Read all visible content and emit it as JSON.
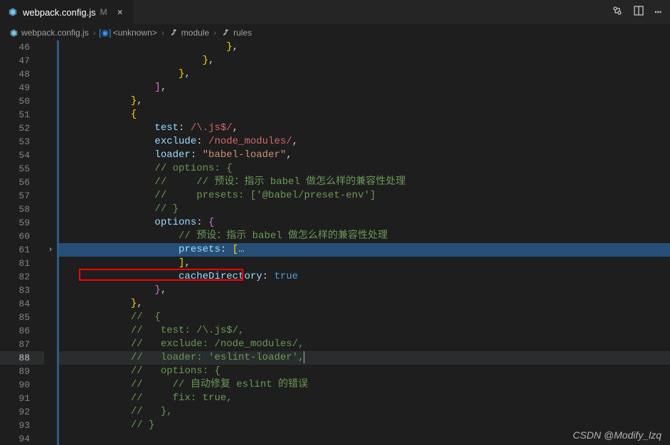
{
  "tab": {
    "filename": "webpack.config.js",
    "modified_badge": "M"
  },
  "title_actions": {
    "compare": "⇄",
    "split": "▯",
    "more": "⋯"
  },
  "breadcrumb": {
    "file": "webpack.config.js",
    "segment1": "<unknown>",
    "segment2": "module",
    "segment3": "rules"
  },
  "gutter": {
    "fold_marker": "›"
  },
  "lines": [
    {
      "n": 46,
      "tokens": [
        [
          "                            ",
          "punct"
        ],
        [
          "}",
          {
            "c": "bracket"
          }
        ],
        [
          ",",
          "punct"
        ]
      ]
    },
    {
      "n": 47,
      "tokens": [
        [
          "                        ",
          "punct"
        ],
        [
          "}",
          {
            "c": "bracket"
          }
        ],
        [
          ",",
          "punct"
        ]
      ]
    },
    {
      "n": 48,
      "tokens": [
        [
          "                    ",
          "punct"
        ],
        [
          "}",
          {
            "c": "bracket"
          }
        ],
        [
          ",",
          "punct"
        ]
      ]
    },
    {
      "n": 49,
      "tokens": [
        [
          "                ",
          "punct"
        ],
        [
          "]",
          "bracket2"
        ],
        [
          ",",
          "punct"
        ]
      ]
    },
    {
      "n": 50,
      "tokens": [
        [
          "            ",
          "punct"
        ],
        [
          "}",
          {
            "c": "bracket"
          }
        ],
        [
          ",",
          "punct"
        ]
      ]
    },
    {
      "n": 51,
      "tokens": [
        [
          "            ",
          "punct"
        ],
        [
          "{",
          "bracket"
        ]
      ]
    },
    {
      "n": 52,
      "tokens": [
        [
          "                ",
          "punct"
        ],
        [
          "test",
          "property"
        ],
        [
          ": ",
          "punct"
        ],
        [
          "/\\.js$/",
          "regex"
        ],
        [
          ",",
          "punct"
        ]
      ]
    },
    {
      "n": 53,
      "tokens": [
        [
          "                ",
          "punct"
        ],
        [
          "exclude",
          "property"
        ],
        [
          ": ",
          "punct"
        ],
        [
          "/node_modules/",
          "regex"
        ],
        [
          ",",
          "punct"
        ]
      ]
    },
    {
      "n": 54,
      "tokens": [
        [
          "                ",
          "punct"
        ],
        [
          "loader",
          "property"
        ],
        [
          ": ",
          "punct"
        ],
        [
          "\"babel-loader\"",
          "string"
        ],
        [
          ",",
          "punct"
        ]
      ]
    },
    {
      "n": 55,
      "tokens": [
        [
          "                ",
          "punct"
        ],
        [
          "// options: {",
          "comment"
        ]
      ]
    },
    {
      "n": 56,
      "tokens": [
        [
          "                ",
          "punct"
        ],
        [
          "//     // 预设：指示 babel 做怎么样的兼容性处理",
          "comment"
        ]
      ]
    },
    {
      "n": 57,
      "tokens": [
        [
          "                ",
          "punct"
        ],
        [
          "//     presets: ['@babel/preset-env']",
          "comment"
        ]
      ]
    },
    {
      "n": 58,
      "tokens": [
        [
          "                ",
          "punct"
        ],
        [
          "// }",
          "comment"
        ]
      ]
    },
    {
      "n": 59,
      "tokens": [
        [
          "                ",
          "punct"
        ],
        [
          "options",
          "property"
        ],
        [
          ": ",
          "punct"
        ],
        [
          "{",
          "bracket2"
        ]
      ]
    },
    {
      "n": 60,
      "tokens": [
        [
          "                    ",
          "punct"
        ],
        [
          "// 预设：指示 babel 做怎么样的兼容性处理",
          "comment"
        ]
      ]
    },
    {
      "n": 61,
      "tokens": [
        [
          "                    ",
          "punct"
        ],
        [
          "presets",
          "property"
        ],
        [
          ": ",
          "punct"
        ],
        [
          "[",
          "bracket"
        ],
        [
          "…",
          "punct"
        ]
      ],
      "selected": true,
      "fold": true
    },
    {
      "n": 81,
      "tokens": [
        [
          "                    ",
          "punct"
        ],
        [
          "]",
          "bracket"
        ],
        [
          ",",
          "punct"
        ]
      ]
    },
    {
      "n": 82,
      "tokens": [
        [
          "                    ",
          "punct"
        ],
        [
          "cacheDirectory",
          "property"
        ],
        [
          ": ",
          "punct"
        ],
        [
          "true",
          "bool"
        ]
      ],
      "highlight": true
    },
    {
      "n": 83,
      "tokens": [
        [
          "                ",
          "punct"
        ],
        [
          "}",
          {
            "c": "bracket2"
          }
        ],
        [
          ",",
          "punct"
        ]
      ]
    },
    {
      "n": 84,
      "tokens": [
        [
          "            ",
          "punct"
        ],
        [
          "}",
          {
            "c": "bracket"
          }
        ],
        [
          ",",
          "punct"
        ]
      ]
    },
    {
      "n": 85,
      "tokens": [
        [
          "            ",
          "punct"
        ],
        [
          "//  {",
          "comment"
        ]
      ]
    },
    {
      "n": 86,
      "tokens": [
        [
          "            ",
          "punct"
        ],
        [
          "//   test: /\\.js$/,",
          "comment"
        ]
      ]
    },
    {
      "n": 87,
      "tokens": [
        [
          "            ",
          "punct"
        ],
        [
          "//   exclude: /node_modules/,",
          "comment"
        ]
      ]
    },
    {
      "n": 88,
      "tokens": [
        [
          "            ",
          "punct"
        ],
        [
          "//   loader: 'eslint-loader',",
          "comment"
        ]
      ],
      "current": true,
      "cursor": true
    },
    {
      "n": 89,
      "tokens": [
        [
          "            ",
          "punct"
        ],
        [
          "//   options: {",
          "comment"
        ]
      ]
    },
    {
      "n": 90,
      "tokens": [
        [
          "            ",
          "punct"
        ],
        [
          "//     // 自动修复 eslint 的错误",
          "comment"
        ]
      ]
    },
    {
      "n": 91,
      "tokens": [
        [
          "            ",
          "punct"
        ],
        [
          "//     fix: true,",
          "comment"
        ]
      ]
    },
    {
      "n": 92,
      "tokens": [
        [
          "            ",
          "punct"
        ],
        [
          "//   },",
          "comment"
        ]
      ]
    },
    {
      "n": 93,
      "tokens": [
        [
          "            ",
          "punct"
        ],
        [
          "// }",
          "comment"
        ]
      ]
    },
    {
      "n": 94,
      "tokens": [
        [
          "",
          "punct"
        ]
      ]
    }
  ],
  "watermark": "CSDN @Modify_lzq"
}
